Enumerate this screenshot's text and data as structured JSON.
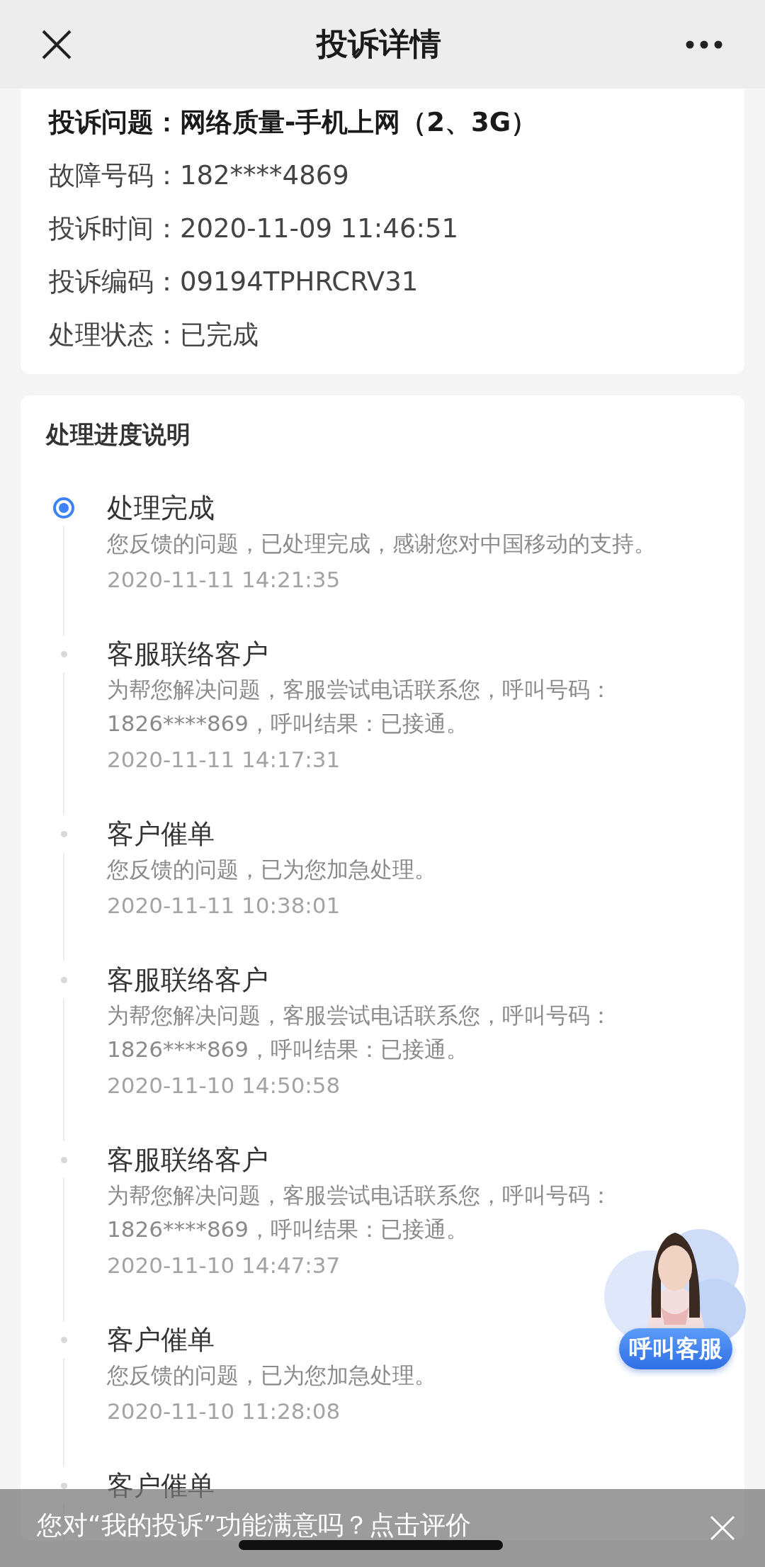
{
  "header": {
    "title": "投诉详情"
  },
  "details": [
    {
      "label": "投诉问题：",
      "value": "网络质量-手机上网（2、3G）",
      "emphasis": true
    },
    {
      "label": "故障号码：",
      "value": "182****4869",
      "emphasis": false
    },
    {
      "label": "投诉时间：",
      "value": "2020-11-09 11:46:51",
      "emphasis": false
    },
    {
      "label": "投诉编码：",
      "value": "09194TPHRCRV31",
      "emphasis": false
    },
    {
      "label": "处理状态：",
      "value": "已完成",
      "emphasis": false
    }
  ],
  "progress": {
    "title": "处理进度说明",
    "steps": [
      {
        "title": "处理完成",
        "description": "您反馈的问题，已处理完成，感谢您对中国移动的支持。",
        "time": "2020-11-11 14:21:35",
        "active": true
      },
      {
        "title": "客服联络客户",
        "description": "为帮您解决问题，客服尝试电话联系您，呼叫号码：1826****869，呼叫结果：已接通。",
        "time": "2020-11-11 14:17:31",
        "active": false
      },
      {
        "title": "客户催单",
        "description": "您反馈的问题，已为您加急处理。",
        "time": "2020-11-11 10:38:01",
        "active": false
      },
      {
        "title": "客服联络客户",
        "description": "为帮您解决问题，客服尝试电话联系您，呼叫号码：1826****869，呼叫结果：已接通。",
        "time": "2020-11-10 14:50:58",
        "active": false
      },
      {
        "title": "客服联络客户",
        "description": "为帮您解决问题，客服尝试电话联系您，呼叫号码：1826****869，呼叫结果：已接通。",
        "time": "2020-11-10 14:47:37",
        "active": false
      },
      {
        "title": "客户催单",
        "description": "您反馈的问题，已为您加急处理。",
        "time": "2020-11-10 11:28:08",
        "active": false
      },
      {
        "title": "客户催单",
        "active": false
      }
    ]
  },
  "service_button": {
    "label": "呼叫客服"
  },
  "rating_banner": {
    "text": "您对“我的投诉”功能满意吗？点击评价"
  }
}
